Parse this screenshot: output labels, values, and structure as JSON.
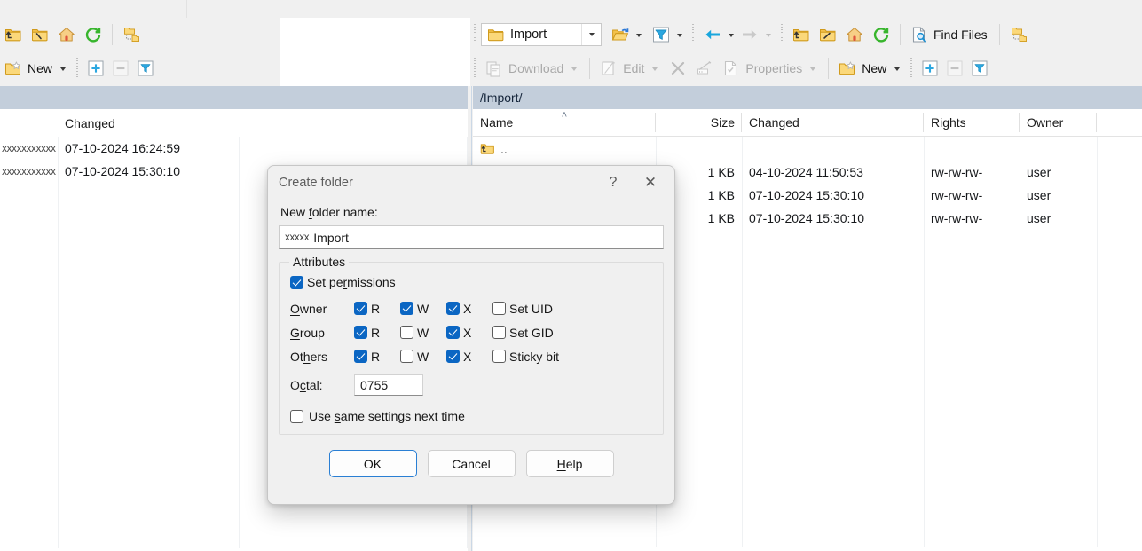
{
  "left_toolbar": {
    "row1": [
      {
        "name": "parent-directory-button",
        "icon": "folder-up-icon",
        "label": ""
      },
      {
        "name": "root-directory-button",
        "icon": "folder-root-icon",
        "label": ""
      },
      {
        "name": "home-directory-button",
        "icon": "home-icon",
        "label": ""
      },
      {
        "name": "refresh-button",
        "icon": "refresh-icon",
        "label": ""
      },
      {
        "name": "new-folder-tree-button",
        "icon": "folder-tree-icon",
        "label": ""
      }
    ],
    "new_label": "New",
    "add_label": "+",
    "remove_label": "−",
    "filter_label": "filter"
  },
  "right_toolbar": {
    "path_value": "Import",
    "open_dir_label": "",
    "filter_label": "",
    "back_label": "",
    "forward_label": "",
    "parent_label": "",
    "root_label": "",
    "home_label": "",
    "refresh_label": "",
    "find_files_label": "Find Files",
    "folder_tree_label": "",
    "download_label": "Download",
    "edit_label": "Edit",
    "delete_label": "",
    "rename_label": "",
    "properties_label": "Properties",
    "new_label": "New",
    "add_label": "+",
    "remove_label": "−"
  },
  "left_panel": {
    "columns": [
      "",
      "Changed"
    ],
    "rows": [
      {
        "redacted": "xxxxxxxxxxx",
        "changed": "07-10-2024 16:24:59"
      },
      {
        "redacted": "xxxxxxxxxxx",
        "changed": "07-10-2024 15:30:10"
      }
    ]
  },
  "right_panel": {
    "path": "/Import/",
    "columns": {
      "name": "Name",
      "size": "Size",
      "changed": "Changed",
      "rights": "Rights",
      "owner": "Owner"
    },
    "sort_indicator": "˄",
    "rows": [
      {
        "name": "..",
        "icon": "folder-up-icon",
        "size": "",
        "changed": "",
        "rights": "",
        "owner": ""
      },
      {
        "name": "",
        "icon": "file-icon",
        "size": "1 KB",
        "changed": "04-10-2024 11:50:53",
        "rights": "rw-rw-rw-",
        "owner": "user"
      },
      {
        "name": "",
        "icon": "file-icon",
        "size": "1 KB",
        "changed": "07-10-2024 15:30:10",
        "rights": "rw-rw-rw-",
        "owner": "user"
      },
      {
        "name": "",
        "icon": "file-icon",
        "size": "1 KB",
        "changed": "07-10-2024 15:30:10",
        "rights": "rw-rw-rw-",
        "owner": "user"
      }
    ]
  },
  "dialog": {
    "title": "Create folder",
    "help_btn": "?",
    "close_btn": "✕",
    "field_label_pre": "New ",
    "field_label_accel": "f",
    "field_label_post": "older name:",
    "folder_name_redacted": "xxxxx",
    "folder_name_value": "Import",
    "attributes_title": "Attributes",
    "set_permissions_pre": "Set pe",
    "set_permissions_accel": "r",
    "set_permissions_post": "missions",
    "set_permissions_checked": true,
    "perm_rows": [
      {
        "who_pre": "",
        "who_accel": "O",
        "who_post": "wner",
        "r": true,
        "w": true,
        "x": true,
        "extra_label": "Set UID",
        "extra_checked": false,
        "r_label": "R",
        "w_label": "W",
        "x_label": "X"
      },
      {
        "who_pre": "",
        "who_accel": "G",
        "who_post": "roup",
        "r": true,
        "w": false,
        "x": true,
        "extra_label": "Set GID",
        "extra_checked": false,
        "r_label": "R",
        "w_label": "W",
        "x_label": "X"
      },
      {
        "who_pre": "Ot",
        "who_accel": "h",
        "who_post": "ers",
        "r": true,
        "w": false,
        "x": true,
        "extra_label": "Sticky bit",
        "extra_checked": false,
        "r_label": "R",
        "w_label": "W",
        "x_label": "X"
      }
    ],
    "octal_label_pre": "O",
    "octal_label_accel": "c",
    "octal_label_post": "tal:",
    "octal_value": "0755",
    "use_same_pre": "Use ",
    "use_same_accel": "s",
    "use_same_post": "ame settings next time",
    "use_same_checked": false,
    "ok_label": "OK",
    "cancel_label": "Cancel",
    "help_pre": "",
    "help_accel": "H",
    "help_post": "elp"
  },
  "colors": {
    "accent": "#0b66c3",
    "toolbar_bg": "#f0f0f0",
    "pathbar_bg": "#c3cedb",
    "folder_yellow": "#f5c147",
    "focus_blue": "#2a7fd4"
  }
}
